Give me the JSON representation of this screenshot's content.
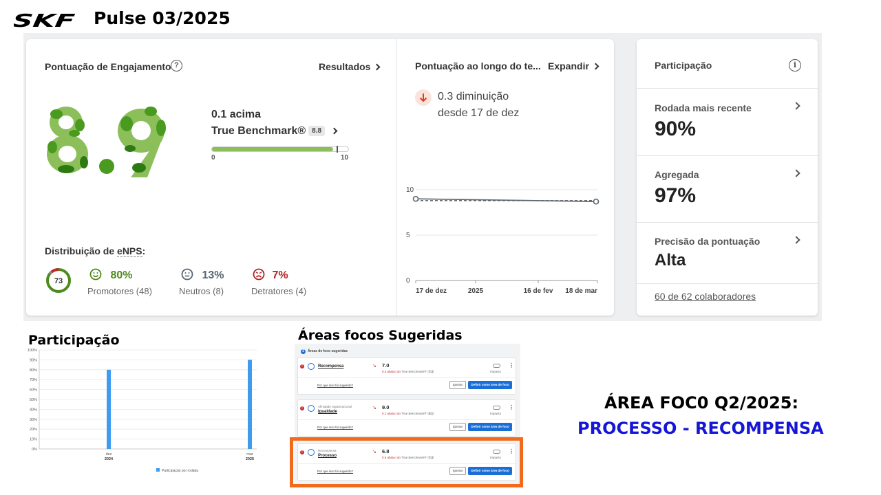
{
  "header": {
    "logo_text": "SKF",
    "title": "Pulse 03/2025"
  },
  "engagement": {
    "title": "Pontuação de Engajamento",
    "help_icon": "question-circle-icon",
    "results_link": "Resultados",
    "score": "8.9",
    "score_colors": [
      "#8cbf5a",
      "#4a9a1f",
      "#2e7a12"
    ],
    "bench_line1": "0.1 acima",
    "bench_line2": "True Benchmark®",
    "bench_badge": "8.8",
    "bar_min": "0",
    "bar_max": "10",
    "bar_value": 8.9,
    "bar_benchmark": 8.8,
    "bar_scale_max": 10
  },
  "enps": {
    "title_prefix": "Distribuição de ",
    "title_term": "eNPS",
    "title_suffix": ":",
    "score": "73",
    "promoters": {
      "pct": "80%",
      "label": "Promotores (48)",
      "color": "#4e8a1c",
      "icon": "smile-face-icon"
    },
    "neutrals": {
      "pct": "13%",
      "label": "Neutros (8)",
      "color": "#5a6673",
      "icon": "neutral-face-icon"
    },
    "detractors": {
      "pct": "7%",
      "label": "Detratores (4)",
      "color": "#b22424",
      "icon": "sad-face-icon"
    }
  },
  "over_time": {
    "title": "Pontuação ao longo do te...",
    "expand_link": "Expandir",
    "change_line1": "0.3 diminuição",
    "change_line2": "desde 17 de dez",
    "change_icon": "arrow-down-icon"
  },
  "participation_card": {
    "title": "Participação",
    "info_icon": "info-icon",
    "recent_label": "Rodada mais recente",
    "recent_value": "90%",
    "aggregate_label": "Agregada",
    "aggregate_value": "97%",
    "precision_label": "Precisão da pontuação",
    "precision_value": "Alta",
    "footer": "60 de 62 colaboradores"
  },
  "participation_section_title": "Participação",
  "focus_section_title": "Áreas focos Sugeridas",
  "focus_panel": {
    "heading_num": "3",
    "heading": "Áreas de foco sugeridas",
    "items": [
      {
        "sup": "",
        "name": "Recompensa",
        "score": "7.0",
        "delta": "0.4 abaixo do",
        "bench": "True Benchmark®",
        "badge": "7.4",
        "impact": "Impacto",
        "why": "Por que isso foi sugerido?",
        "ignore": "Ignorar",
        "define": "Definir como área de foco"
      },
      {
        "sup": "Afinidade organizacional",
        "name": "Igualdade",
        "score": "9.0",
        "delta": "0.1 abaixo do",
        "bench": "True Benchmark®",
        "badge": "9.1",
        "impact": "Impacto",
        "why": "Por que isso foi sugerido?",
        "ignore": "Ignorar",
        "define": "Definir como área de foco"
      },
      {
        "sup": "Recompensa",
        "name": "Processo",
        "score": "6.8",
        "delta": "0.6 abaixo do",
        "bench": "True Benchmark®",
        "badge": "7.4",
        "impact": "Impacto",
        "why": "Por que isso foi sugerido?",
        "ignore": "Ignorar",
        "define": "Definir como área de foco"
      }
    ]
  },
  "focus_area": {
    "label": "ÁREA FOC0 Q2/2025:",
    "value": "PROCESSO - RECOMPENSA",
    "value_color": "#1616d6"
  },
  "chart_data": [
    {
      "type": "line",
      "x": [
        "17 de dez",
        "18 de mar"
      ],
      "x_ticks": [
        "17 de dez",
        "2025",
        "16 de fev",
        "18 de mar"
      ],
      "series": [
        {
          "values": [
            9.0,
            8.7
          ]
        },
        {
          "values": [
            8.8,
            8.8
          ],
          "style": "dashed"
        }
      ],
      "yticks": [
        "0",
        "5",
        "10"
      ],
      "ylim": [
        0,
        10
      ]
    },
    {
      "type": "bar",
      "categories": [
        [
          "dez",
          "2024"
        ],
        [
          "mar",
          "2025"
        ]
      ],
      "values": [
        80,
        90
      ],
      "yticks": [
        "0%",
        "10%",
        "20%",
        "30%",
        "40%",
        "50%",
        "60%",
        "70%",
        "80%",
        "90%",
        "100%"
      ],
      "ylim": [
        0,
        100
      ],
      "legend": "Participação por rodada",
      "color": "#3d9bf0"
    }
  ]
}
